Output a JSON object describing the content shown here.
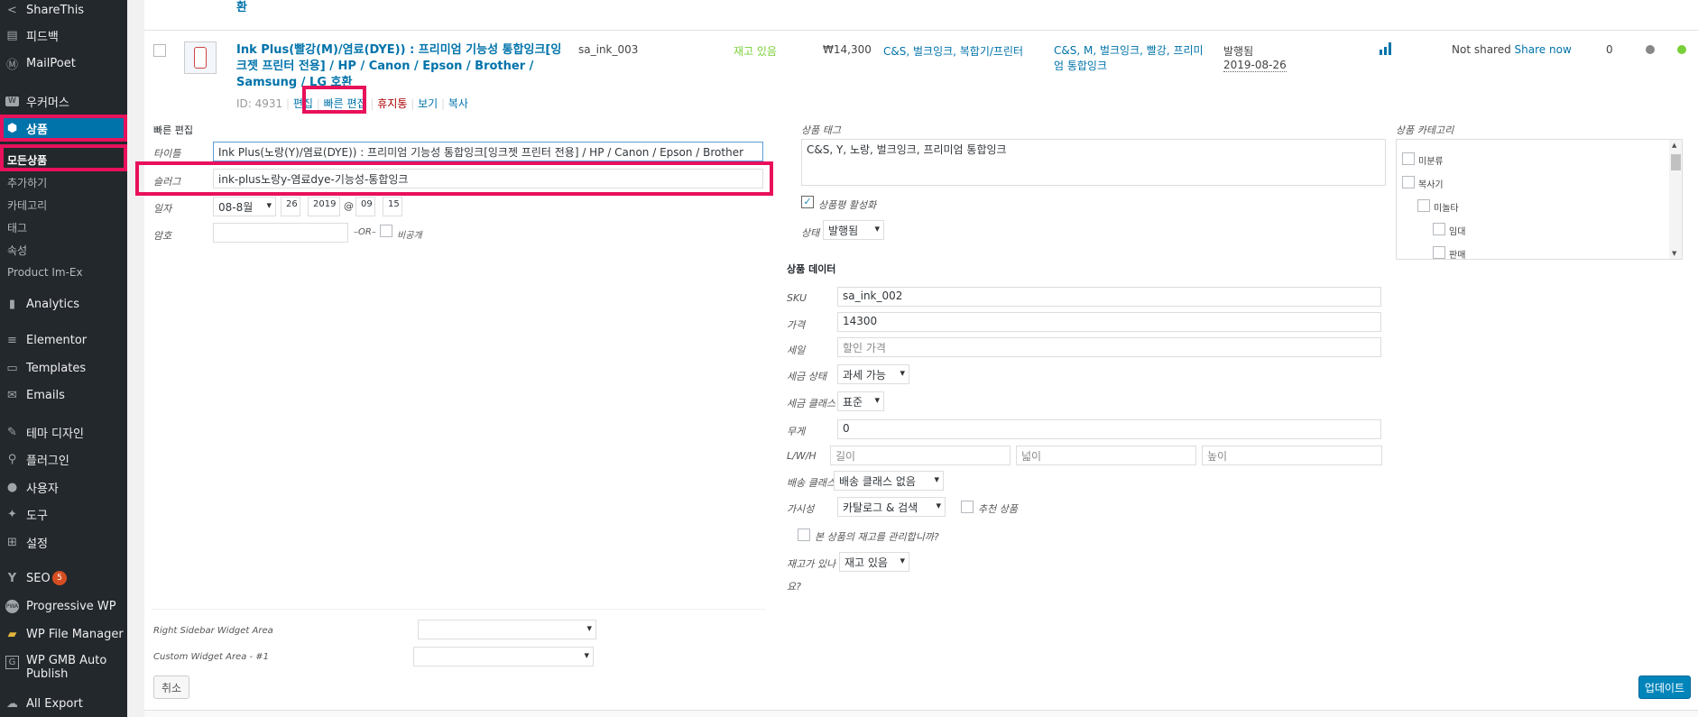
{
  "sidebar": {
    "top_items": [
      {
        "label": "ShareThis",
        "icon": "share-icon"
      },
      {
        "label": "피드백",
        "icon": "feedback-icon"
      },
      {
        "label": "MailPoet",
        "icon": "mailpoet-icon"
      },
      {
        "label": "우커머스",
        "icon": "woocommerce-icon"
      },
      {
        "label": "상품",
        "icon": "product-box-icon"
      }
    ],
    "submenu": [
      "모든상품",
      "추가하기",
      "카테고리",
      "태그",
      "속성",
      "Product Im-Ex"
    ],
    "bottom_items": [
      {
        "label": "Analytics",
        "icon": "bar-chart-icon"
      },
      {
        "label": "Elementor",
        "icon": "elementor-icon"
      },
      {
        "label": "Templates",
        "icon": "folder-icon"
      },
      {
        "label": "Emails",
        "icon": "mail-icon"
      },
      {
        "label": "테마 디자인",
        "icon": "paint-brush-icon"
      },
      {
        "label": "플러그인",
        "icon": "plugin-icon"
      },
      {
        "label": "사용자",
        "icon": "user-icon"
      },
      {
        "label": "도구",
        "icon": "wrench-icon"
      },
      {
        "label": "설정",
        "icon": "settings-icon"
      },
      {
        "label": "SEO",
        "icon": "yoast-icon",
        "badge": "5"
      },
      {
        "label": "Progressive WP",
        "icon": "pwa-icon"
      },
      {
        "label": "WP File Manager",
        "icon": "file-manager-icon"
      },
      {
        "label": "WP GMB Auto Publish",
        "icon": "gmb-icon"
      },
      {
        "label": "All Export",
        "icon": "export-icon"
      }
    ]
  },
  "prev_row_tail": "환",
  "product": {
    "title": "Ink Plus(빨강(M)/염료(DYE)) : 프리미엄 기능성 통합잉크[잉크젯 프린터 전용] / HP / Canon / Epson / Brother / Samsung / LG 호환",
    "id_text": "ID: 4931",
    "actions": {
      "edit": "편집",
      "quick_edit": "빠른 편집",
      "trash": "휴지통",
      "view": "보기",
      "copy": "복사"
    },
    "sku": "sa_ink_003",
    "stock": "재고 있음",
    "price": "₩14,300",
    "categories": "C&S, 벌크잉크, 복합기/프린터",
    "tags": "C&S, M, 벌크잉크, 빨강, 프리미엄 통합잉크",
    "status": "발행됨",
    "date": "2019-08-26",
    "share_status": "Not shared",
    "share_link": "Share now",
    "count": "0"
  },
  "quick_edit": {
    "heading": "빠른 편집",
    "title_label": "타이틀",
    "title_value": "Ink Plus(노랑(Y)/염료(DYE)) : 프리미엄 기능성 통합잉크[잉크젯 프린터 전용] / HP / Canon / Epson / Brother",
    "slug_label": "슬러그",
    "slug_value": "ink-plus노랑y-염료dye-기능성-통합잉크",
    "date_label": "일자",
    "month": "08-8월",
    "day": "26",
    "year": "2019",
    "at": "@",
    "hour": "09",
    "minute": "15",
    "password_label": "암호",
    "or_text": "–OR–",
    "private_label": "비공개",
    "tags_label": "상품 태그",
    "tags_value": "C&S, Y, 노랑, 벌크잉크, 프리미엄 통합잉크",
    "comments_label": "상품평 활성화",
    "status_label": "상태",
    "status_value": "발행됨",
    "cat_label": "상품 카테고리",
    "cat_items": [
      "미분류",
      "복사기",
      "미놀타",
      "임대",
      "판매"
    ],
    "data_heading": "상품 데이터",
    "sku_label": "SKU",
    "sku_value": "sa_ink_002",
    "price_label": "가격",
    "price_value": "14300",
    "sale_label": "세일",
    "sale_placeholder": "할인 가격",
    "tax_status_label": "세금 상태",
    "tax_status_value": "과세 가능",
    "tax_class_label": "세금 클래스",
    "tax_class_value": "표준",
    "weight_label": "무게",
    "weight_value": "0",
    "lwh_label": "L/W/H",
    "length_placeholder": "길이",
    "width_placeholder": "넓이",
    "height_placeholder": "높이",
    "shipping_label": "배송 클래스",
    "shipping_value": "배송 클래스 없음",
    "visibility_label": "가시성",
    "visibility_value": "카탈로그 & 검색",
    "featured_label": "추천 상품",
    "manage_stock_label": "본 상품의 재고를 관리합니까?",
    "in_stock_label_1": "재고가 있나",
    "in_stock_label_2": "요?",
    "in_stock_value": "재고 있음",
    "sidebar_widget_label": "Right Sidebar Widget Area",
    "custom_widget_label": "Custom Widget Area - #1",
    "cancel": "취소",
    "update": "업데이트"
  },
  "colors": {
    "accent": "#0073aa",
    "highlight": "#e8115b",
    "stock": "#7ad03a",
    "sidebar": "#23282d"
  }
}
